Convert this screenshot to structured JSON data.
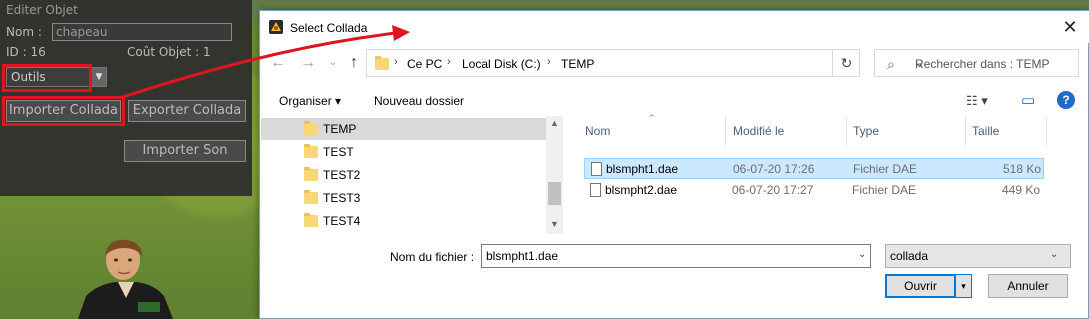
{
  "game_panel": {
    "title": "Editer Objet",
    "name_label": "Nom :",
    "name_value": "chapeau",
    "id_text": "ID : 16",
    "cost_text": "Coût Objet : 1",
    "select_value": "Outils",
    "select_arrow": "▼",
    "import_collada": "Importer Collada",
    "export_collada": "Exporter Collada",
    "import_sound": "Importer Son"
  },
  "dialog": {
    "title": "Select Collada",
    "close": "✕",
    "nav": {
      "back": "←",
      "forward": "→",
      "up": "↑"
    },
    "breadcrumbs": [
      "Ce PC",
      "Local Disk (C:)",
      "TEMP"
    ],
    "breadcrumb_sep": "›",
    "addr_dropdown": "⌄",
    "refresh": "↻",
    "search_placeholder": "Rechercher dans : TEMP",
    "search_icon": "⌕",
    "organize": "Organiser ▾",
    "new_folder": "Nouveau dossier",
    "view_icon": "☷ ▾",
    "preview_icon": "▭",
    "help": "?",
    "folders": [
      "TEMP",
      "TEST",
      "TEST2",
      "TEST3",
      "TEST4"
    ],
    "scroll_up": "▲",
    "scroll_down": "▼",
    "columns": [
      "Nom",
      "Modifié le",
      "Type",
      "Taille"
    ],
    "sort_arrow": "⌃",
    "files": [
      {
        "name": "blsmpht1.dae",
        "modified": "06-07-20 17:26",
        "type": "Fichier DAE",
        "size": "518 Ko"
      },
      {
        "name": "blsmpht2.dae",
        "modified": "06-07-20 17:27",
        "type": "Fichier DAE",
        "size": "449 Ko"
      }
    ],
    "filename_label": "Nom du fichier :",
    "filename_value": "blsmpht1.dae",
    "filename_dropdown": "⌄",
    "filetype_value": "collada",
    "filetype_dropdown": "⌄",
    "open_label": "Ouvrir",
    "open_dropdown": "▾",
    "cancel_label": "Annuler"
  },
  "colors": {
    "annotation_red": "#e0141e",
    "selection_blue": "#cce8ff",
    "accent": "#0078d7"
  }
}
